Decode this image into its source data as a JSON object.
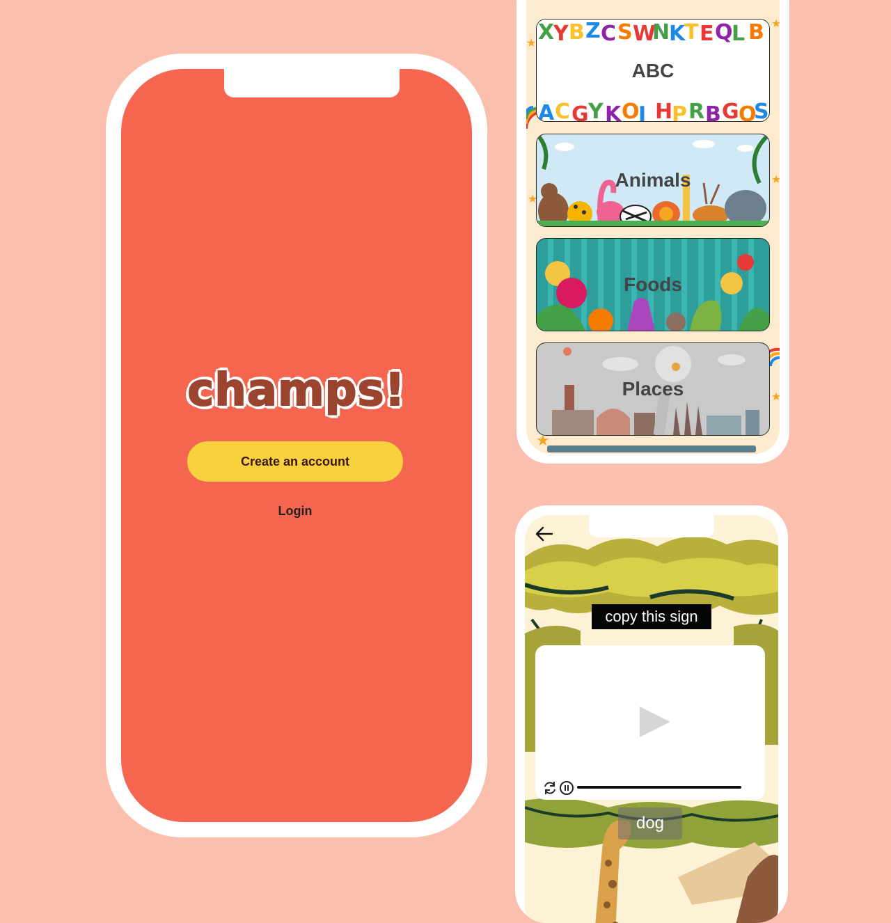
{
  "colors": {
    "background": "#fbbfae",
    "splash_bg": "#f46650",
    "primary_button": "#f8d13f",
    "logo_text": "#9b4430",
    "categories_bg": "#fdebcf"
  },
  "splash": {
    "logo": "champs!",
    "create_account_label": "Create an account",
    "login_label": "Login"
  },
  "categories": {
    "items": [
      {
        "label": "ABC"
      },
      {
        "label": "Animals"
      },
      {
        "label": "Foods"
      },
      {
        "label": "Places"
      }
    ]
  },
  "player": {
    "back_icon": "arrow-left-icon",
    "instruction": "copy this sign",
    "play_icon": "play-icon",
    "replay_icon": "replay-icon",
    "pause_icon": "pause-icon",
    "word": "dog"
  }
}
